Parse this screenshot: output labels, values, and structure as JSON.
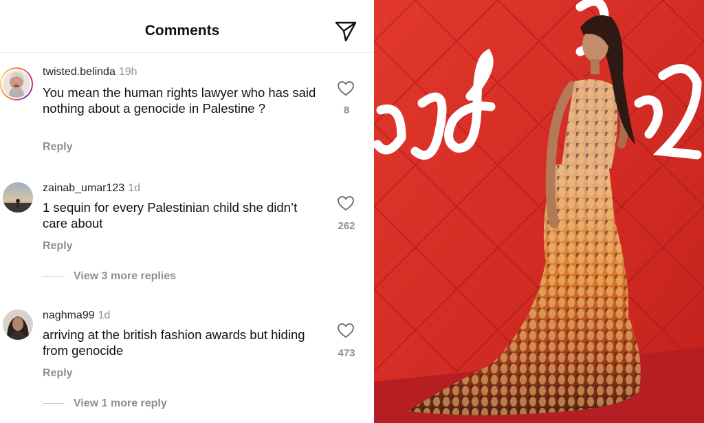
{
  "header": {
    "title": "Comments",
    "send_icon": "paper-plane-icon"
  },
  "comments": [
    {
      "username": "twisted.belinda",
      "time": "19h",
      "text": "You mean the human rights lawyer who has said nothing about a genocide in Palestine ?",
      "reply_label": "Reply",
      "likes": "8",
      "has_story_ring": true
    },
    {
      "username": "zainab_umar123",
      "time": "1d",
      "text": "1 sequin for every Palestinian child she didn’t care about",
      "reply_label": "Reply",
      "likes": "262",
      "view_more": "View 3 more replies"
    },
    {
      "username": "naghma99",
      "time": "1d",
      "text": "arriving at the british fashion awards but hiding from genocide",
      "reply_label": "Reply",
      "likes": "473",
      "view_more": "View 1 more reply"
    }
  ],
  "colors": {
    "accent_gray": "#8e8e8e",
    "photo_background": "#d6281f",
    "carpet": "#b51e23"
  }
}
